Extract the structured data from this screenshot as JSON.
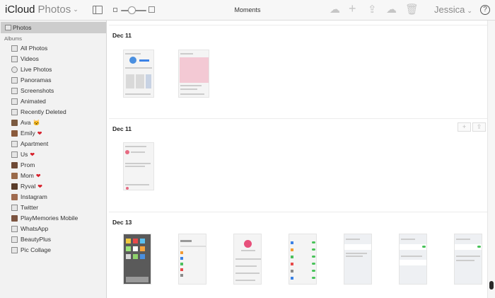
{
  "header": {
    "brand": "iCloud",
    "app_name": "Photos",
    "view_title": "Moments",
    "user_name": "Jessica",
    "help_label": "?"
  },
  "icons": {
    "upload": "cloud-upload-icon",
    "add": "plus-icon",
    "share": "share-icon",
    "download": "cloud-download-icon",
    "delete": "trash-icon"
  },
  "sidebar": {
    "photos_label": "Photos",
    "albums_header": "Albums",
    "albums": [
      {
        "label": "All Photos",
        "icon": "album-icon"
      },
      {
        "label": "Videos",
        "icon": "video-icon"
      },
      {
        "label": "Live Photos",
        "icon": "live-photo-icon"
      },
      {
        "label": "Panoramas",
        "icon": "panorama-icon"
      },
      {
        "label": "Screenshots",
        "icon": "screenshot-icon"
      },
      {
        "label": "Animated",
        "icon": "animated-icon"
      },
      {
        "label": "Recently Deleted",
        "icon": "trash-icon"
      },
      {
        "label": "Ava",
        "icon": "thumbnail",
        "emoji": "🐱"
      },
      {
        "label": "Emily",
        "icon": "thumbnail",
        "emoji": "❤"
      },
      {
        "label": "Apartment",
        "icon": "album-icon"
      },
      {
        "label": "Us",
        "icon": "album-icon",
        "emoji": "❤"
      },
      {
        "label": "Prom",
        "icon": "thumbnail"
      },
      {
        "label": "Mom",
        "icon": "thumbnail",
        "emoji": "❤"
      },
      {
        "label": "Ryval",
        "icon": "thumbnail",
        "emoji": "❤"
      },
      {
        "label": "Instagram",
        "icon": "thumbnail"
      },
      {
        "label": "Twitter",
        "icon": "album-icon"
      },
      {
        "label": "PlayMemories Mobile",
        "icon": "thumbnail"
      },
      {
        "label": "WhatsApp",
        "icon": "album-icon"
      },
      {
        "label": "BeautyPlus",
        "icon": "album-icon"
      },
      {
        "label": "Pic Collage",
        "icon": "album-icon"
      }
    ]
  },
  "moments": [
    {
      "date": "Dec 11"
    },
    {
      "date": "Dec 11"
    },
    {
      "date": "Dec 13"
    }
  ],
  "colors": {
    "heart": "#d71f2a",
    "selected_bg": "#cdcdcd",
    "toolbar_disabled": "#c6c6c6"
  }
}
